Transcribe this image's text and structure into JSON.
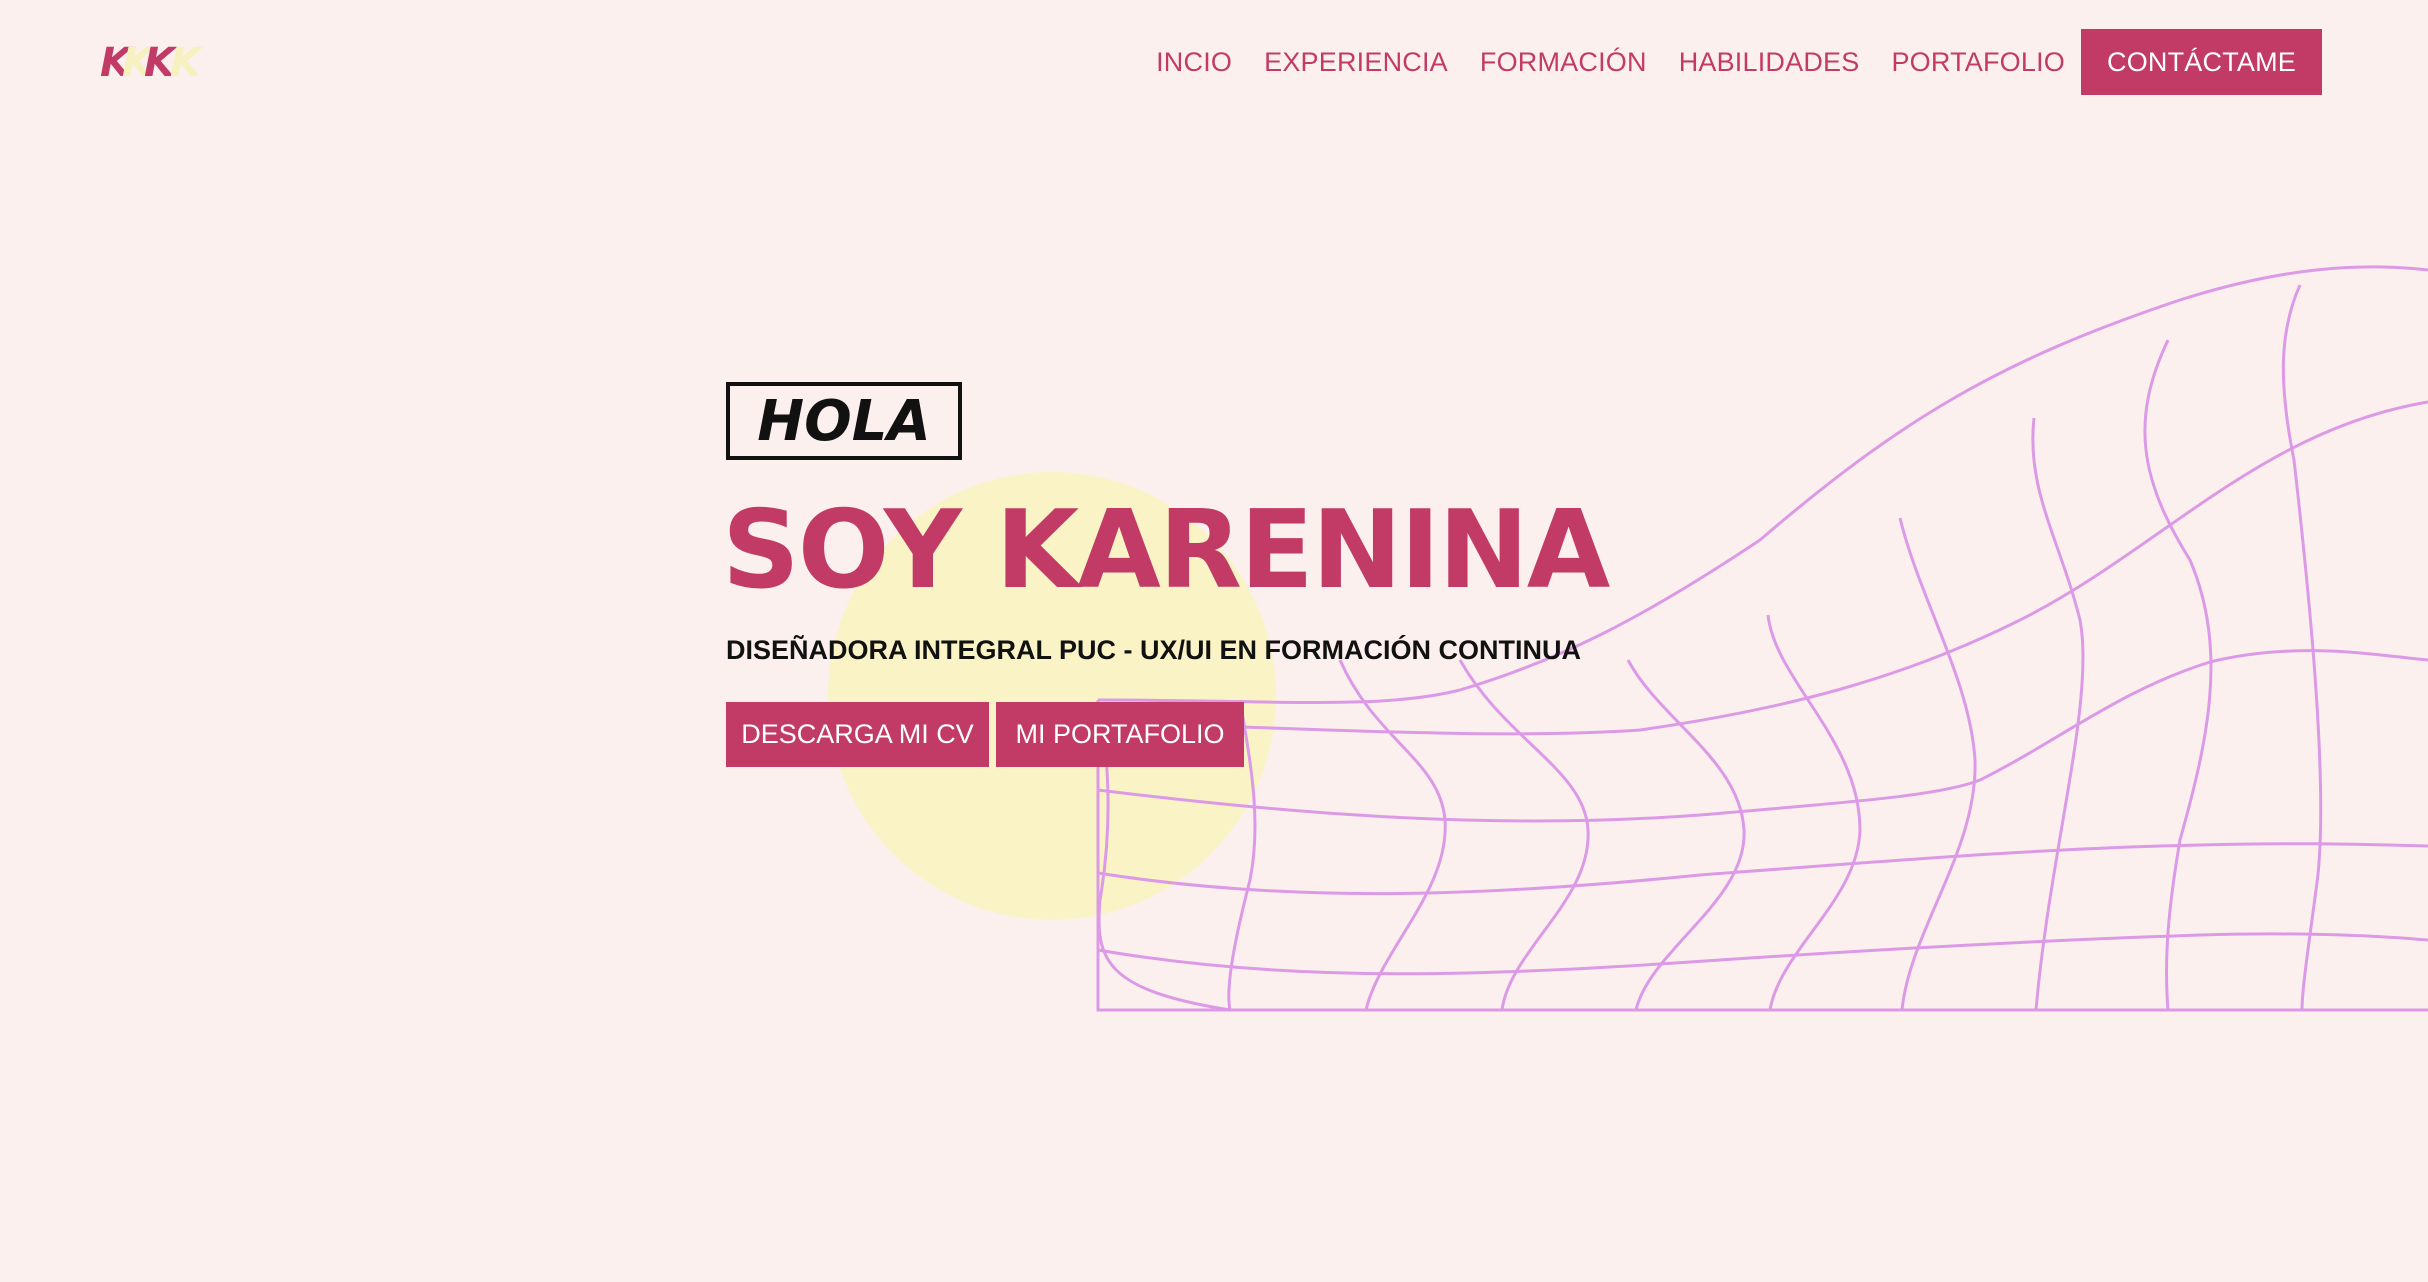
{
  "logo": {
    "letters": [
      "K",
      "K",
      "K",
      "K"
    ]
  },
  "nav": {
    "items": [
      "INCIO",
      "EXPERIENCIA",
      "FORMACIÓN",
      "HABILIDADES",
      "PORTAFOLIO"
    ],
    "contact": "CONTÁCTAME"
  },
  "hero": {
    "greeting": "HOLA",
    "name": "SOY KARENINA",
    "subtitle": "DISEÑADORA INTEGRAL PUC - UX/UI EN FORMACIÓN CONTINUA",
    "cv_button": "DESCARGA MI CV",
    "portfolio_button": "MI PORTAFOLIO"
  },
  "colors": {
    "background": "#fcf0ef",
    "accent": "#c23b67",
    "circle": "#f9f3c5",
    "grid": "#dc9ae6"
  }
}
